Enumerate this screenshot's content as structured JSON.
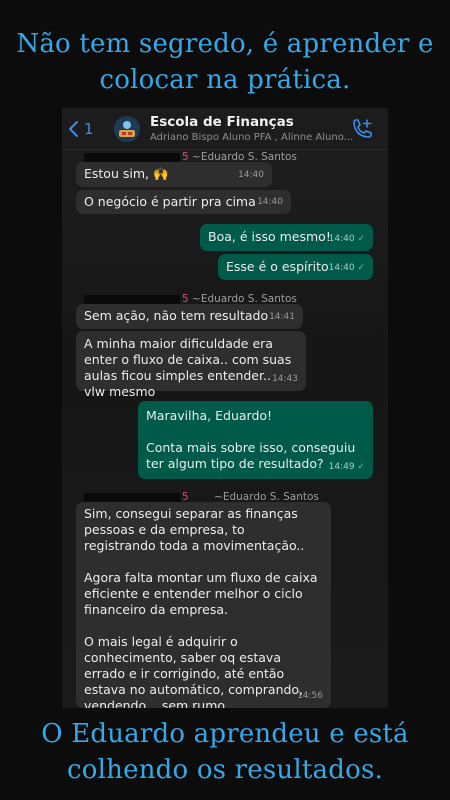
{
  "story": {
    "top_text": "Não tem segredo, é aprender e colocar na prática.",
    "bottom_text": "O Eduardo aprendeu e está colhendo os resultados."
  },
  "header": {
    "back_count": "1",
    "group_name": "Escola de Finanças",
    "members": "Adriano Bispo Aluno PFA , Alinne Aluno...",
    "icons": {
      "back": "chevron-left-icon",
      "call": "phone-add-icon"
    }
  },
  "messages": [
    {
      "type": "in",
      "sender_suffix": "5",
      "sender": "~Eduardo S. Santos",
      "text": "Estou sim, 🙌",
      "time": "14:40"
    },
    {
      "type": "in",
      "text": "O negócio é partir pra cima",
      "time": "14:40"
    },
    {
      "type": "out",
      "text": "Boa, é isso mesmo!",
      "time": "14:40"
    },
    {
      "type": "out",
      "text": "Esse é o espírito",
      "time": "14:40"
    },
    {
      "type": "in",
      "sender_suffix": "5",
      "sender": "~Eduardo S. Santos",
      "text": "Sem ação, não tem resultado",
      "time": "14:41"
    },
    {
      "type": "in",
      "text": "A minha maior dificuldade era enter o fluxo de caixa.. com suas aulas ficou simples entender.. vlw mesmo",
      "time": "14:43"
    },
    {
      "type": "out",
      "text_lines": [
        "Maravilha, Eduardo!",
        "",
        "Conta mais sobre isso, conseguiu ter algum tipo de resultado?"
      ],
      "time": "14:49"
    },
    {
      "type": "in",
      "sender_suffix": "5",
      "sender": "~Eduardo S. Santos",
      "text_lines": [
        "Sim, consegui separar as finanças pessoas e da empresa, to registrando toda a movimentação..",
        "",
        "Agora falta montar um fluxo de caixa eficiente e entender melhor o ciclo financeiro da empresa.",
        "",
        "O mais legal é adquirir o conhecimento, saber oq estava errado e ir corrigindo, até então estava no automático, comprando, vendendo... sem rumo"
      ],
      "time": "14:56"
    }
  ],
  "colors": {
    "accent_text": "#36a8e8",
    "outgoing_bubble": "#005a4a",
    "incoming_bubble": "#2e2e2e",
    "link_blue": "#3b8fe8",
    "sender_suffix": "#d64d8a"
  }
}
